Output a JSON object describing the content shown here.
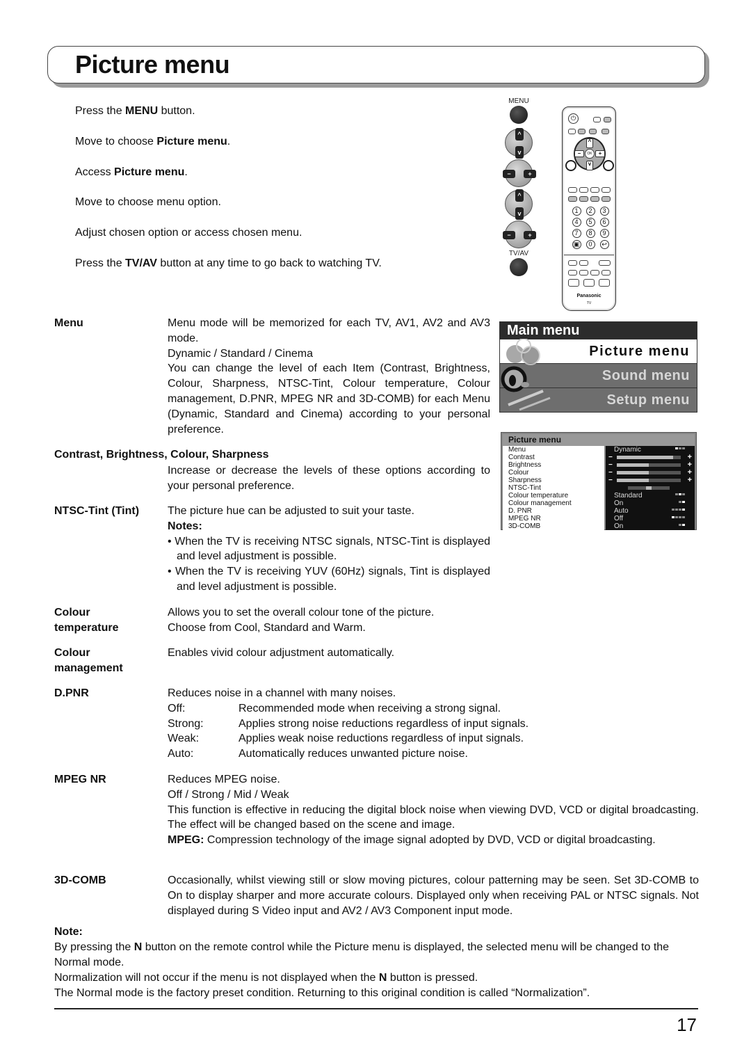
{
  "page": {
    "title": "Picture menu",
    "page_number": "17"
  },
  "steps": [
    {
      "pre": "Press the ",
      "bold": "MENU",
      "post": " button."
    },
    {
      "pre": "Move to choose ",
      "bold": "Picture menu",
      "post": "."
    },
    {
      "pre": "Access ",
      "bold": "Picture menu",
      "post": "."
    },
    {
      "pre": "Move to choose menu option.",
      "bold": "",
      "post": ""
    },
    {
      "pre": "Adjust chosen option or access chosen menu.",
      "bold": "",
      "post": ""
    },
    {
      "pre": "Press the ",
      "bold": "TV/AV",
      "post": " button at any time to go back to watching TV."
    }
  ],
  "button_column": {
    "menu_label": "MENU",
    "tvav_label": "TV/AV",
    "up_glyph": "^",
    "down_glyph": "v",
    "minus_glyph": "−",
    "plus_glyph": "+"
  },
  "remote": {
    "brand": "Panasonic",
    "brand_sub": "TV",
    "ok_label": "OK",
    "numbers": [
      "1",
      "2",
      "3",
      "4",
      "5",
      "6",
      "7",
      "8",
      "9",
      "▣",
      "0",
      "↩"
    ]
  },
  "main_menu": {
    "title": "Main menu",
    "items": [
      {
        "label": "Picture menu",
        "selected": true
      },
      {
        "label": "Sound menu",
        "selected": false
      },
      {
        "label": "Setup menu",
        "selected": false
      }
    ]
  },
  "picture_menu": {
    "title": "Picture menu",
    "rows": [
      {
        "label": "Menu",
        "type": "option",
        "value": "Dynamic",
        "option_index": 0,
        "option_count": 3
      },
      {
        "label": "Contrast",
        "type": "slider",
        "level": 0.88
      },
      {
        "label": "Brightness",
        "type": "slider",
        "level": 0.5
      },
      {
        "label": "Colour",
        "type": "slider",
        "level": 0.5
      },
      {
        "label": "Sharpness",
        "type": "slider",
        "level": 0.5
      },
      {
        "label": "NTSC-Tint",
        "type": "center",
        "level": 0.5
      },
      {
        "label": "Colour temperature",
        "type": "option",
        "value": "Standard",
        "option_index": 1,
        "option_count": 3
      },
      {
        "label": "Colour management",
        "type": "option",
        "value": "On",
        "option_index": 1,
        "option_count": 2
      },
      {
        "label": "D. PNR",
        "type": "option",
        "value": "Auto",
        "option_index": 3,
        "option_count": 4
      },
      {
        "label": "MPEG NR",
        "type": "option",
        "value": "Off",
        "option_index": 0,
        "option_count": 4
      },
      {
        "label": "3D-COMB",
        "type": "option",
        "value": "On",
        "option_index": 1,
        "option_count": 2
      }
    ]
  },
  "definitions": {
    "menu": {
      "term": "Menu",
      "lines": [
        "Menu mode will be memorized for each TV, AV1, AV2 and AV3 mode.",
        "Dynamic / Standard / Cinema",
        "You can change the level of each Item (Contrast, Brightness, Colour, Sharpness, NTSC-Tint, Colour temperature, Colour management, D.PNR, MPEG NR and 3D-COMB) for each Menu (Dynamic, Standard and Cinema) according to your personal preference."
      ]
    },
    "contrast": {
      "term": "Contrast, Brightness, Colour, Sharpness",
      "text": "Increase or decrease the levels of these options according to your personal preference."
    },
    "ntsc": {
      "term": "NTSC-Tint (Tint)",
      "text": "The picture hue can be adjusted to suit your taste.",
      "notes_label": "Notes:",
      "notes": [
        "• When the TV is receiving NTSC signals, NTSC-Tint is displayed and level adjustment is possible.",
        "• When the TV is receiving YUV (60Hz) signals, Tint is displayed and level adjustment is possible."
      ]
    },
    "colour_temperature": {
      "term_line1": "Colour",
      "term_line2": "temperature",
      "lines": [
        "Allows you to set the overall colour tone of the picture.",
        "Choose from Cool, Standard and Warm."
      ]
    },
    "colour_management": {
      "term_line1": "Colour",
      "term_line2": "management",
      "text": "Enables vivid colour adjustment automatically."
    },
    "dpnr": {
      "term": "D.PNR",
      "text": "Reduces noise in a channel with many noises.",
      "options": [
        {
          "key": "Off:",
          "desc": "Recommended mode when receiving a strong signal."
        },
        {
          "key": "Strong:",
          "desc": "Applies strong noise reductions regardless of input signals."
        },
        {
          "key": "Weak:",
          "desc": "Applies weak noise reductions regardless of input signals."
        },
        {
          "key": "Auto:",
          "desc": "Automatically reduces unwanted picture noise."
        }
      ]
    },
    "mpeg_nr": {
      "term": "MPEG NR",
      "lines": [
        "Reduces MPEG noise.",
        "Off / Strong / Mid / Weak",
        "This function is effective in reducing the digital block noise when viewing DVD, VCD or digital broadcasting. The effect will be changed based on the scene and image."
      ],
      "mpeg_label": "MPEG:",
      "mpeg_text": " Compression technology of the image signal adopted by DVD, VCD or digital broadcasting."
    },
    "comb": {
      "term": "3D-COMB",
      "text": "Occasionally, whilst viewing still or slow moving pictures, colour patterning may be seen. Set 3D-COMB to On to display sharper and more accurate colours. Displayed only when receiving PAL or NTSC signals. Not displayed during S Video input and AV2 / AV3 Component input mode."
    }
  },
  "note": {
    "label": "Note:",
    "p1_pre": "By pressing the ",
    "p1_bold": "N",
    "p1_post": " button on the remote control while the Picture menu is displayed, the selected menu will be changed to the Normal mode.",
    "p2_pre": "Normalization will not occur if the menu is not displayed when the ",
    "p2_bold": "N",
    "p2_post": " button is pressed.",
    "p3": "The Normal mode is the factory preset condition. Returning to this original condition is called “Normalization”."
  }
}
